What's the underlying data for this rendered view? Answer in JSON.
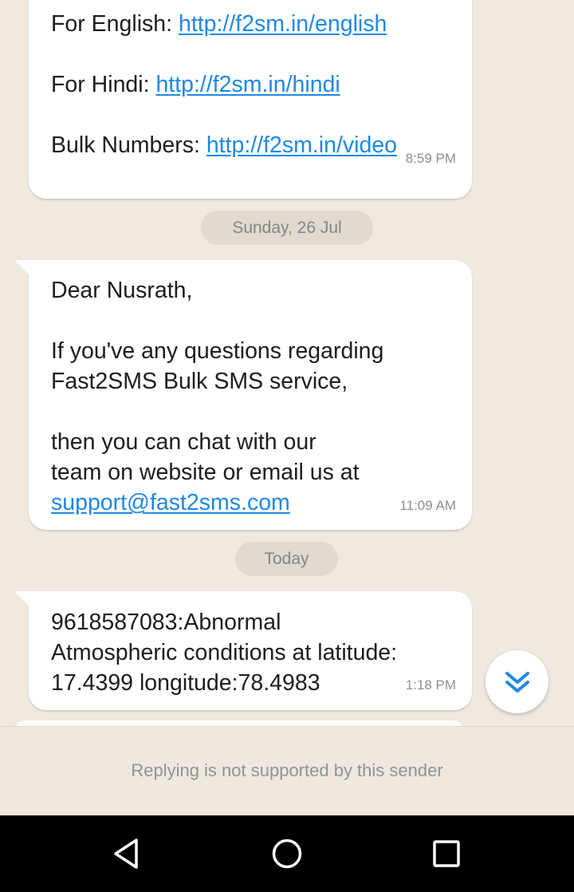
{
  "messages": [
    {
      "lines": [
        {
          "label": "For English: ",
          "link": "http://f2sm.in/english"
        },
        {
          "label": "For Hindi: ",
          "link": "http://f2sm.in/hindi"
        },
        {
          "label": "Bulk Numbers: ",
          "link": "http://f2sm.in/video"
        }
      ],
      "time": "8:59 PM"
    },
    {
      "greeting": "Dear Nusrath,",
      "para1": [
        "If you've any questions regarding",
        "Fast2SMS Bulk SMS service,"
      ],
      "para2": [
        "then you can chat with our",
        "team on website or email us at"
      ],
      "email": "support@fast2sms.com",
      "time": "11:09 AM"
    },
    {
      "lines": [
        "9618587083:Abnormal",
        "Atmospheric conditions at latitude:",
        "17.4399 longitude:78.4983"
      ],
      "time": "1:18 PM"
    }
  ],
  "date_separators": [
    "Sunday, 26 Jul",
    "Today"
  ],
  "footer": {
    "text": "Replying is not supported by this sender"
  },
  "colors": {
    "chat_background": "#f0e9df",
    "bubble": "#ffffff",
    "link": "#1f88e5",
    "fab_icon": "#1f88e5"
  },
  "icons": {
    "scroll_fab": "double-chevron-down-icon",
    "nav_back": "triangle-back-icon",
    "nav_home": "circle-home-icon",
    "nav_recent": "square-recents-icon"
  }
}
